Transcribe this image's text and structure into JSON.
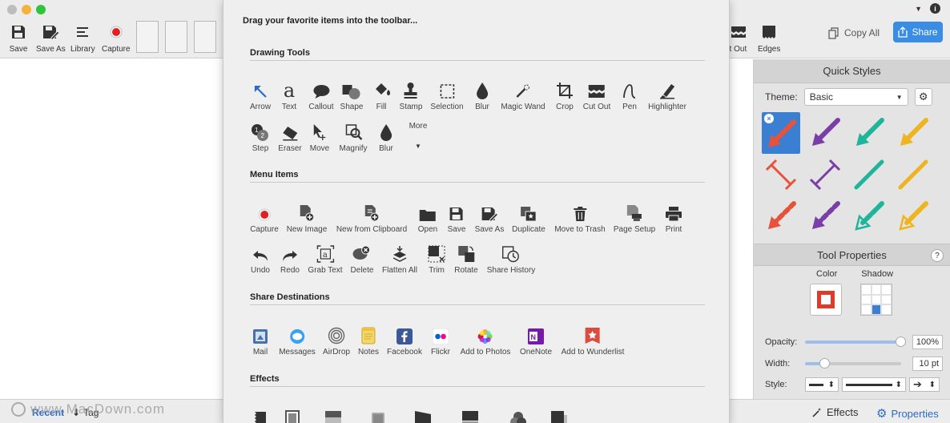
{
  "toolbar": {
    "buttons": [
      {
        "label": "Save",
        "icon": "save-icon"
      },
      {
        "label": "Save As",
        "icon": "save-as-icon"
      },
      {
        "label": "Library",
        "icon": "library-icon"
      },
      {
        "label": "Capture",
        "icon": "capture-icon"
      }
    ],
    "right_buttons": [
      {
        "label": "Cut Out",
        "icon": "cut-out-icon"
      },
      {
        "label": "Edges",
        "icon": "edges-icon"
      }
    ],
    "copy_all_label": "Copy All",
    "share_label": "Share"
  },
  "sheet": {
    "title": "Drag your favorite items into the toolbar...",
    "sections": {
      "drawing_tools": {
        "label": "Drawing Tools",
        "row1": [
          "Arrow",
          "Text",
          "Callout",
          "Shape",
          "Fill",
          "Stamp",
          "Selection",
          "Blur",
          "Magic Wand",
          "Crop",
          "Cut Out",
          "Pen",
          "Highlighter"
        ],
        "row2": [
          "Step",
          "Eraser",
          "Move",
          "Magnify",
          "Blur",
          "More"
        ]
      },
      "menu_items": {
        "label": "Menu Items",
        "row1": [
          "Capture",
          "New Image",
          "New from Clipboard",
          "Open",
          "Save",
          "Save As",
          "Duplicate",
          "Move to Trash",
          "Page Setup",
          "Print"
        ],
        "row2": [
          "Undo",
          "Redo",
          "Grab Text",
          "Delete",
          "Flatten All",
          "Trim",
          "Rotate",
          "Share History"
        ]
      },
      "share_destinations": {
        "label": "Share Destinations",
        "row1": [
          "Mail",
          "Messages",
          "AirDrop",
          "Notes",
          "Facebook",
          "Flickr",
          "Add to Photos",
          "OneNote",
          "Add to Wunderlist"
        ]
      },
      "effects": {
        "label": "Effects"
      }
    }
  },
  "right_panel": {
    "quick_styles_title": "Quick Styles",
    "theme_label": "Theme:",
    "theme_value": "Basic",
    "tool_properties_title": "Tool Properties",
    "color_label": "Color",
    "shadow_label": "Shadow",
    "opacity_label": "Opacity:",
    "opacity_value": "100%",
    "opacity_fraction": 1.0,
    "width_label": "Width:",
    "width_value": "10 pt",
    "style_label": "Style:",
    "accent_color": "#3b7fd2",
    "swatch_color": "#e03a2a"
  },
  "bottom_bar": {
    "recent_label": "Recent",
    "tag_label": "Tag",
    "effects_label": "Effects",
    "properties_label": "Properties"
  },
  "watermark": "www.MacDown.com"
}
